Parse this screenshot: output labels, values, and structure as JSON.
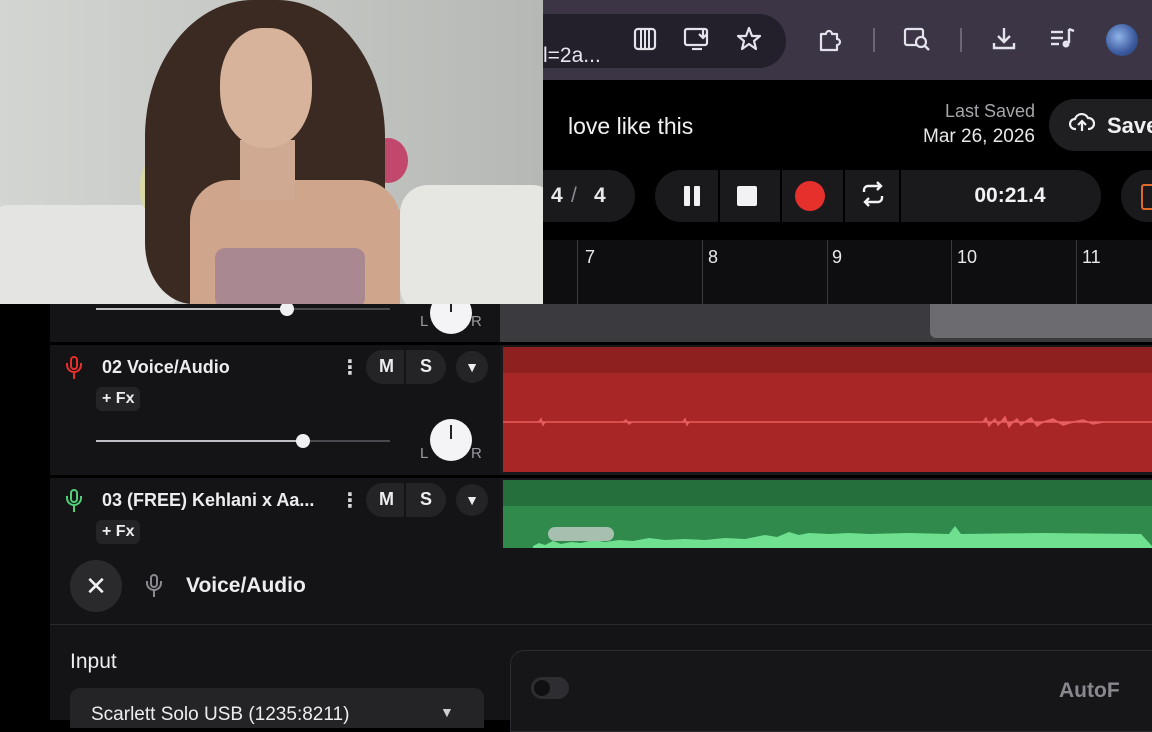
{
  "browser": {
    "url_fragment": "l=2a...",
    "icons": [
      "piano-icon",
      "install-icon",
      "star-icon",
      "extensions-icon",
      "search-page-icon",
      "download-icon",
      "media-icon",
      "avatar"
    ]
  },
  "header": {
    "project_title": "love like this",
    "last_saved_label": "Last Saved",
    "last_saved_date": "Mar 26, 2026",
    "save_label": "Save"
  },
  "transport": {
    "meter_top": "4",
    "meter_sep": "/",
    "meter_bottom": "4",
    "time": "00:21.4",
    "record_color": "#e5302c"
  },
  "ruler": {
    "bars": [
      "7",
      "8",
      "9",
      "10",
      "11"
    ]
  },
  "tracks": [
    {
      "number": "02",
      "name": "02  Voice/Audio",
      "mute_label": "M",
      "solo_label": "S",
      "fx_label": "+ Fx",
      "pan_left": "L",
      "pan_right": "R",
      "volume": 0.7,
      "mic_color": "#e5302c",
      "clip_color": "#a82626"
    },
    {
      "number": "03",
      "name": "03  (FREE) Kehlani x Aa...",
      "mute_label": "M",
      "solo_label": "S",
      "fx_label": "+ Fx",
      "mic_color": "#4fcf78",
      "clip_color": "#2f8a4c"
    }
  ],
  "partial_track": {
    "pan_left": "L",
    "pan_right": "R"
  },
  "bottom_panel": {
    "title": "Voice/Audio",
    "input_label": "Input",
    "input_value": "Scarlett Solo USB (1235:8211)",
    "autof_label": "AutoF"
  }
}
